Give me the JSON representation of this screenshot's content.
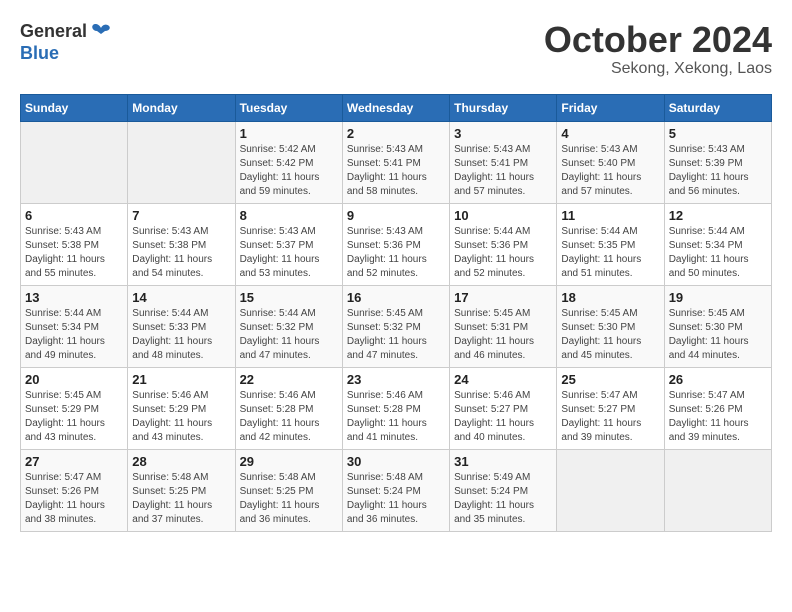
{
  "header": {
    "logo_general": "General",
    "logo_blue": "Blue",
    "main_title": "October 2024",
    "subtitle": "Sekong, Xekong, Laos"
  },
  "calendar": {
    "days_of_week": [
      "Sunday",
      "Monday",
      "Tuesday",
      "Wednesday",
      "Thursday",
      "Friday",
      "Saturday"
    ],
    "weeks": [
      [
        {
          "day": "",
          "info": ""
        },
        {
          "day": "",
          "info": ""
        },
        {
          "day": "1",
          "info": "Sunrise: 5:42 AM\nSunset: 5:42 PM\nDaylight: 11 hours and 59 minutes."
        },
        {
          "day": "2",
          "info": "Sunrise: 5:43 AM\nSunset: 5:41 PM\nDaylight: 11 hours and 58 minutes."
        },
        {
          "day": "3",
          "info": "Sunrise: 5:43 AM\nSunset: 5:41 PM\nDaylight: 11 hours and 57 minutes."
        },
        {
          "day": "4",
          "info": "Sunrise: 5:43 AM\nSunset: 5:40 PM\nDaylight: 11 hours and 57 minutes."
        },
        {
          "day": "5",
          "info": "Sunrise: 5:43 AM\nSunset: 5:39 PM\nDaylight: 11 hours and 56 minutes."
        }
      ],
      [
        {
          "day": "6",
          "info": "Sunrise: 5:43 AM\nSunset: 5:38 PM\nDaylight: 11 hours and 55 minutes."
        },
        {
          "day": "7",
          "info": "Sunrise: 5:43 AM\nSunset: 5:38 PM\nDaylight: 11 hours and 54 minutes."
        },
        {
          "day": "8",
          "info": "Sunrise: 5:43 AM\nSunset: 5:37 PM\nDaylight: 11 hours and 53 minutes."
        },
        {
          "day": "9",
          "info": "Sunrise: 5:43 AM\nSunset: 5:36 PM\nDaylight: 11 hours and 52 minutes."
        },
        {
          "day": "10",
          "info": "Sunrise: 5:44 AM\nSunset: 5:36 PM\nDaylight: 11 hours and 52 minutes."
        },
        {
          "day": "11",
          "info": "Sunrise: 5:44 AM\nSunset: 5:35 PM\nDaylight: 11 hours and 51 minutes."
        },
        {
          "day": "12",
          "info": "Sunrise: 5:44 AM\nSunset: 5:34 PM\nDaylight: 11 hours and 50 minutes."
        }
      ],
      [
        {
          "day": "13",
          "info": "Sunrise: 5:44 AM\nSunset: 5:34 PM\nDaylight: 11 hours and 49 minutes."
        },
        {
          "day": "14",
          "info": "Sunrise: 5:44 AM\nSunset: 5:33 PM\nDaylight: 11 hours and 48 minutes."
        },
        {
          "day": "15",
          "info": "Sunrise: 5:44 AM\nSunset: 5:32 PM\nDaylight: 11 hours and 47 minutes."
        },
        {
          "day": "16",
          "info": "Sunrise: 5:45 AM\nSunset: 5:32 PM\nDaylight: 11 hours and 47 minutes."
        },
        {
          "day": "17",
          "info": "Sunrise: 5:45 AM\nSunset: 5:31 PM\nDaylight: 11 hours and 46 minutes."
        },
        {
          "day": "18",
          "info": "Sunrise: 5:45 AM\nSunset: 5:30 PM\nDaylight: 11 hours and 45 minutes."
        },
        {
          "day": "19",
          "info": "Sunrise: 5:45 AM\nSunset: 5:30 PM\nDaylight: 11 hours and 44 minutes."
        }
      ],
      [
        {
          "day": "20",
          "info": "Sunrise: 5:45 AM\nSunset: 5:29 PM\nDaylight: 11 hours and 43 minutes."
        },
        {
          "day": "21",
          "info": "Sunrise: 5:46 AM\nSunset: 5:29 PM\nDaylight: 11 hours and 43 minutes."
        },
        {
          "day": "22",
          "info": "Sunrise: 5:46 AM\nSunset: 5:28 PM\nDaylight: 11 hours and 42 minutes."
        },
        {
          "day": "23",
          "info": "Sunrise: 5:46 AM\nSunset: 5:28 PM\nDaylight: 11 hours and 41 minutes."
        },
        {
          "day": "24",
          "info": "Sunrise: 5:46 AM\nSunset: 5:27 PM\nDaylight: 11 hours and 40 minutes."
        },
        {
          "day": "25",
          "info": "Sunrise: 5:47 AM\nSunset: 5:27 PM\nDaylight: 11 hours and 39 minutes."
        },
        {
          "day": "26",
          "info": "Sunrise: 5:47 AM\nSunset: 5:26 PM\nDaylight: 11 hours and 39 minutes."
        }
      ],
      [
        {
          "day": "27",
          "info": "Sunrise: 5:47 AM\nSunset: 5:26 PM\nDaylight: 11 hours and 38 minutes."
        },
        {
          "day": "28",
          "info": "Sunrise: 5:48 AM\nSunset: 5:25 PM\nDaylight: 11 hours and 37 minutes."
        },
        {
          "day": "29",
          "info": "Sunrise: 5:48 AM\nSunset: 5:25 PM\nDaylight: 11 hours and 36 minutes."
        },
        {
          "day": "30",
          "info": "Sunrise: 5:48 AM\nSunset: 5:24 PM\nDaylight: 11 hours and 36 minutes."
        },
        {
          "day": "31",
          "info": "Sunrise: 5:49 AM\nSunset: 5:24 PM\nDaylight: 11 hours and 35 minutes."
        },
        {
          "day": "",
          "info": ""
        },
        {
          "day": "",
          "info": ""
        }
      ]
    ]
  }
}
